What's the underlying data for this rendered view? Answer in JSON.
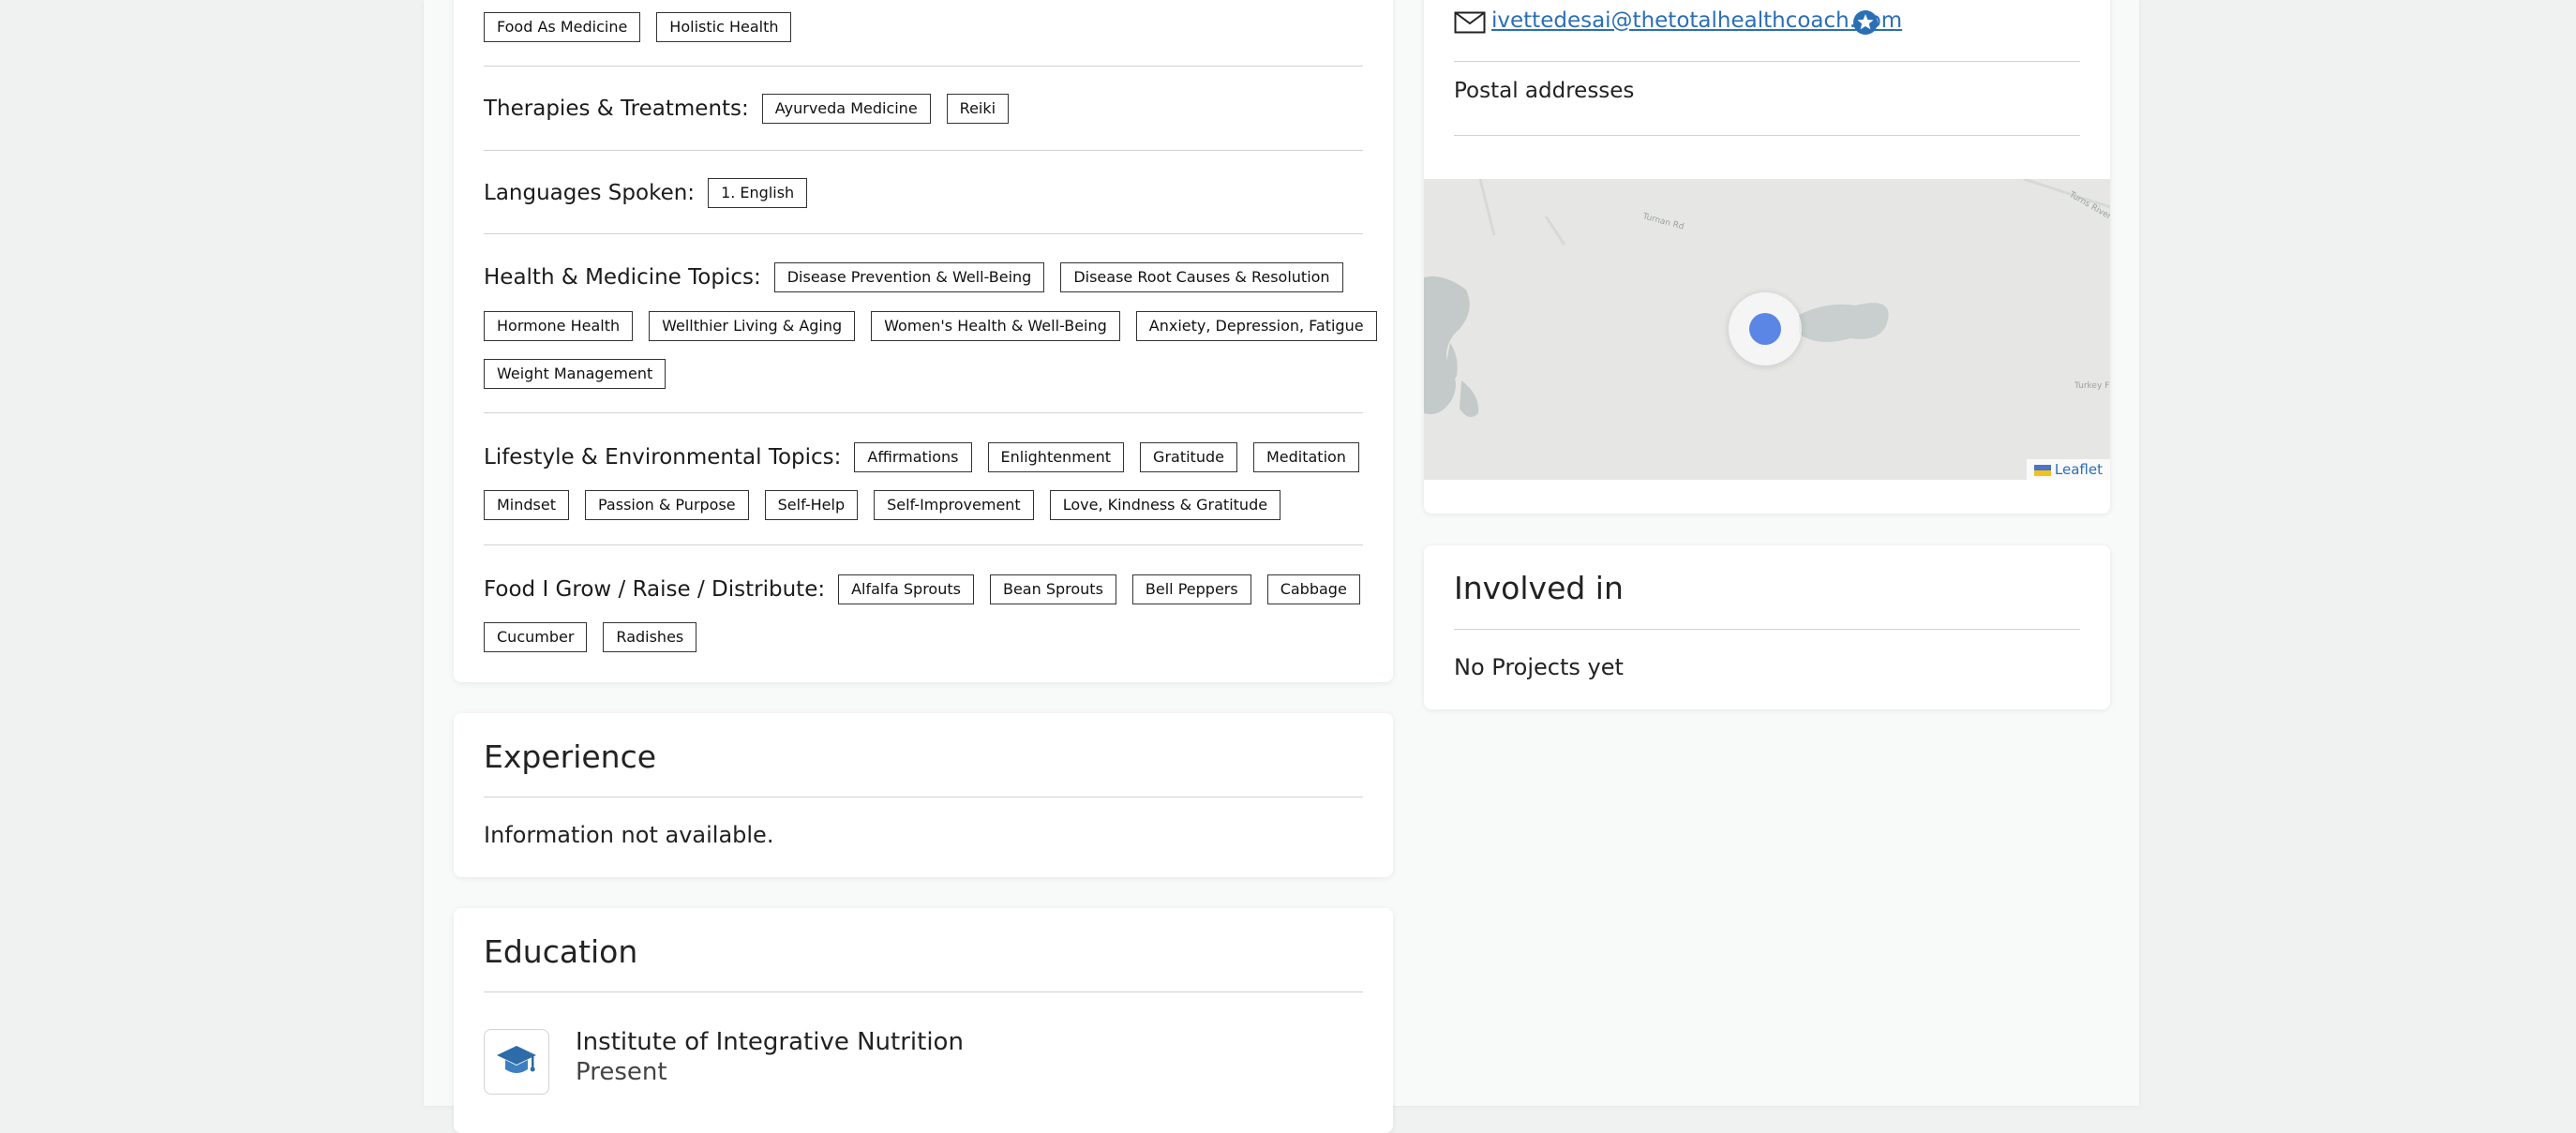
{
  "tags": {
    "top": [
      "Food As Medicine",
      "Holistic Health"
    ],
    "therapies": {
      "label": "Therapies & Treatments:",
      "items": [
        "Ayurveda Medicine",
        "Reiki"
      ]
    },
    "languages": {
      "label": "Languages Spoken:",
      "items": [
        "1. English"
      ]
    },
    "health": {
      "label": "Health & Medicine Topics:",
      "row1": [
        "Disease Prevention & Well-Being",
        "Disease Root Causes & Resolution"
      ],
      "row2": [
        "Hormone Health",
        "Wellthier Living & Aging",
        "Women's Health & Well-Being",
        "Anxiety, Depression, Fatigue"
      ],
      "row3": [
        "Weight Management"
      ]
    },
    "lifestyle": {
      "label": "Lifestyle & Environmental Topics:",
      "row1": [
        "Affirmations",
        "Enlightenment",
        "Gratitude",
        "Meditation"
      ],
      "row2": [
        "Mindset",
        "Passion & Purpose",
        "Self-Help",
        "Self-Improvement",
        "Love, Kindness & Gratitude"
      ]
    },
    "food": {
      "label": "Food I Grow / Raise / Distribute:",
      "row1": [
        "Alfalfa Sprouts",
        "Bean Sprouts",
        "Bell Peppers",
        "Cabbage"
      ],
      "row2": [
        "Cucumber",
        "Radishes"
      ]
    }
  },
  "experience": {
    "title": "Experience",
    "text": "Information not available."
  },
  "education": {
    "title": "Education",
    "school": "Institute of Integrative Nutrition",
    "period": "Present"
  },
  "contact": {
    "email": "ivettedesai@thetotalhealthcoach.com",
    "postal_title": "Postal addresses",
    "map_attribution": "Leaflet"
  },
  "involved": {
    "title": "Involved in",
    "text": "No Projects yet"
  },
  "colors": {
    "link": "#2a6fb6",
    "marker": "#5b86e5",
    "page_bg": "#eff2f1"
  },
  "icons": {
    "email": "envelope-icon",
    "verified": "star-badge-icon",
    "education": "graduation-cap-icon",
    "attribution_flag": "flag-icon"
  }
}
